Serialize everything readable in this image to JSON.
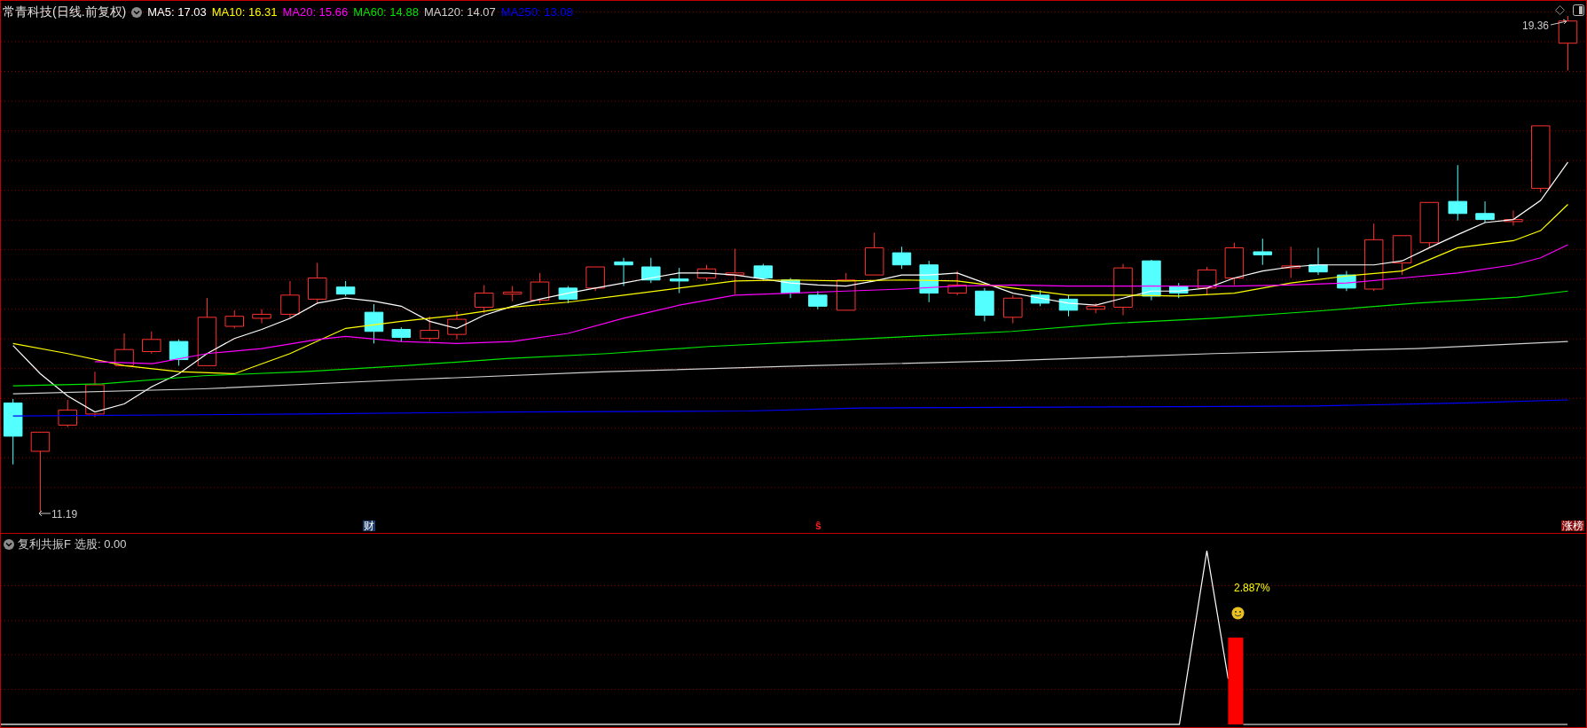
{
  "header": {
    "title": "常青科技(日线.前复权)",
    "ma_legend": [
      {
        "label": "MA5: 17.03",
        "color": "#ffffff"
      },
      {
        "label": "MA10: 16.31",
        "color": "#ffff00"
      },
      {
        "label": "MA20: 15.66",
        "color": "#ff00ff"
      },
      {
        "label": "MA60: 14.88",
        "color": "#00e600"
      },
      {
        "label": "MA120: 14.07",
        "color": "#d0d0d0"
      },
      {
        "label": "MA250: 13.08",
        "color": "#0000ff"
      }
    ]
  },
  "price_labels": {
    "high": "19.36",
    "low": "11.19"
  },
  "markers": [
    {
      "text": "财",
      "kind": "finance"
    },
    {
      "text": "ŝ",
      "kind": "s"
    },
    {
      "text": "涨榜",
      "kind": "rank"
    }
  ],
  "indicator": {
    "title": "复利共振F",
    "reading": "选股: 0.00",
    "annotation": "2.887%"
  }
}
